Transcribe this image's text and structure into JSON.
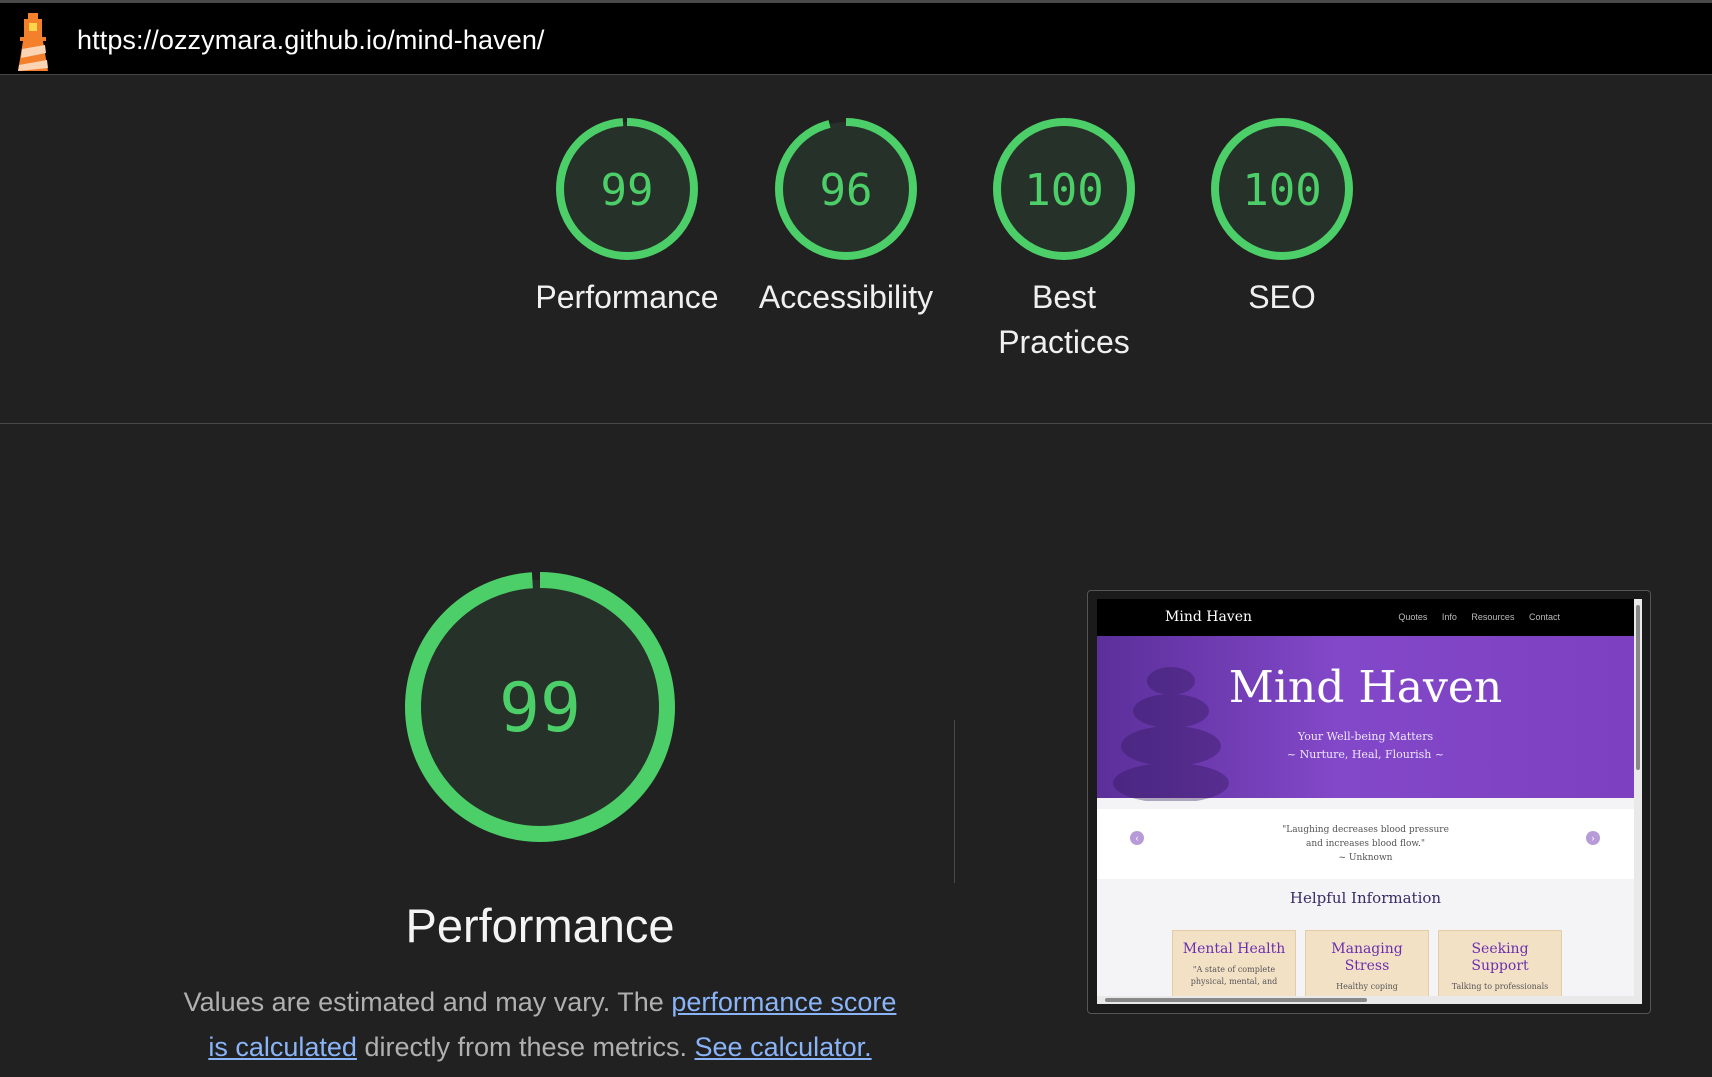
{
  "browser": {
    "url": "https://ozzymara.github.io/mind-haven/"
  },
  "colors": {
    "accent_pass": "#4cce68",
    "gauge_fill": "#263229",
    "link": "#8ab4f8"
  },
  "icons": {
    "logo": "lighthouse-icon"
  },
  "scores": [
    {
      "id": "performance",
      "value": "99",
      "label": "Performance",
      "fraction": 0.99
    },
    {
      "id": "accessibility",
      "value": "96",
      "label": "Accessibility",
      "fraction": 0.96
    },
    {
      "id": "best-practices",
      "value": "100",
      "label": "Best Practices",
      "fraction": 1.0
    },
    {
      "id": "seo",
      "value": "100",
      "label": "SEO",
      "fraction": 1.0
    }
  ],
  "performance_section": {
    "score": "99",
    "score_fraction": 0.99,
    "title": "Performance",
    "desc_prefix": "Values are estimated and may vary. The ",
    "link_score": "performance score is calculated",
    "desc_middle": " directly from these metrics. ",
    "link_calculator": "See calculator."
  },
  "screenshot": {
    "brand": "Mind Haven",
    "nav": [
      "Quotes",
      "Info",
      "Resources",
      "Contact"
    ],
    "hero_title": "Mind Haven",
    "hero_sub1": "Your Well-being Matters",
    "hero_sub2": "~ Nurture, Heal, Flourish ~",
    "quote1": "\"Laughing decreases blood pressure",
    "quote2": "and increases blood flow.\"",
    "quote3": "~ Unknown",
    "section_title": "Helpful Information",
    "cards": [
      {
        "title": "Mental Health",
        "text1": "\"A state of complete",
        "text2": "physical, mental, and"
      },
      {
        "title": "Managing Stress",
        "text1": "Healthy coping",
        "text2": ""
      },
      {
        "title": "Seeking Support",
        "text1": "Talking to professionals",
        "text2": ""
      }
    ]
  }
}
